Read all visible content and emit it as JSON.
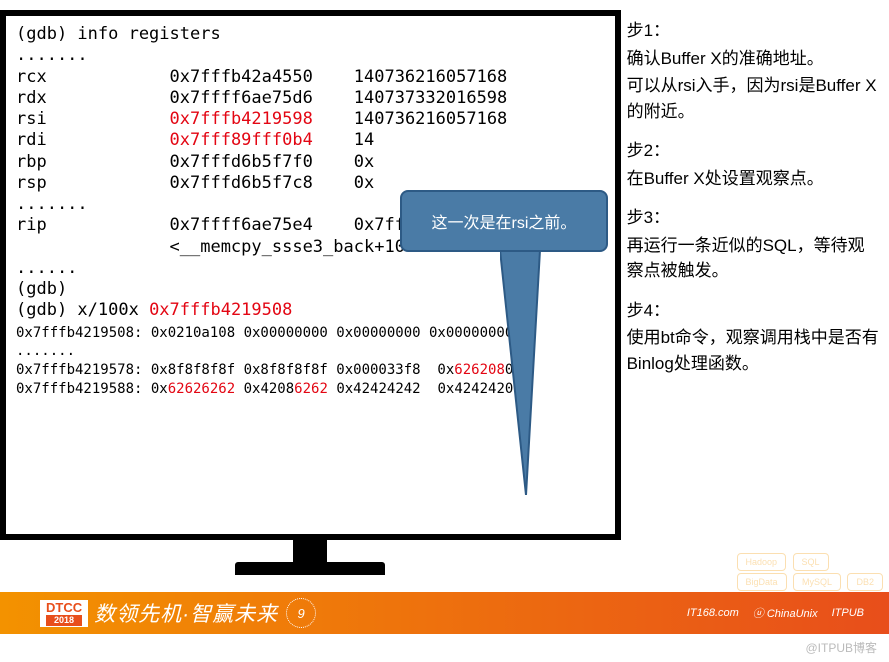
{
  "terminal": {
    "cmd1": "(gdb) info registers",
    "dots": ".......",
    "dots2": "......",
    "reg_rcx": "rcx            0x7fffb42a4550    140736216057168",
    "reg_rdx": "rdx            0x7ffff6ae75d6    140737332016598",
    "reg_rsi_name": "rsi            ",
    "reg_rsi_val": "0x7fffb4219598",
    "reg_rsi_dec": "    140736216057168",
    "reg_rdi_name": "rdi            ",
    "reg_rdi_val": "0x7fff89fff0b4",
    "reg_rdi_dec": "    14",
    "reg_rbp": "rbp            0x7fffd6b5f7f0    0x",
    "reg_rsp": "rsp            0x7fffd6b5f7c8    0x",
    "reg_rip": "rip            0x7ffff6ae75e4    0x7fff     e75e4",
    "memcpy": "               <__memcpy_ssse3_back+10    >",
    "gdb_empty": "(gdb)",
    "cmd2_pre": "(gdb) x/100x ",
    "cmd2_addr": "0x7fffb4219508",
    "mem1": "0x7fffb4219508: 0x0210a108 0x00000000 0x00000000 0x00000000",
    "mem_dots": ".......",
    "mem2_pre": "0x7fffb4219578: 0x8f8f8f8f 0x8f8f8f8f 0x000033f8  0x",
    "mem2_red": "626208",
    "mem2_post": "00",
    "mem3_pre": "0x7fffb4219588: 0x",
    "mem3_red1": "62626262",
    "mem3_mid": " 0x4208",
    "mem3_red2": "6262",
    "mem3_post": " 0x42424242  0x42424200"
  },
  "callout": "这一次是在rsi之前。",
  "steps": {
    "s1t": "步1：",
    "s1a": "确认Buffer X的准确地址。",
    "s1b": "可以从rsi入手，因为rsi是Buffer X的附近。",
    "s2t": "步2：",
    "s2a": "在Buffer X处设置观察点。",
    "s3t": "步3：",
    "s3a": "再运行一条近似的SQL，等待观察点被触发。",
    "s4t": "步4：",
    "s4a": "使用bt命令，观察调用栈中是否有Binlog处理函数。"
  },
  "footer": {
    "dtcc": "DTCC",
    "year": "2018",
    "slogan": "数领先机·智赢未来",
    "badge": "9",
    "logo1": "IT168.com",
    "logo2": "ⓤ ChinaUnix",
    "logo3": "ITPUB"
  },
  "hex_bg": {
    "h1": "Hadoop",
    "h2": "SQL",
    "h3": "BigData",
    "h4": "MySQL",
    "h5": "DB2"
  },
  "watermark": "@ITPUB博客"
}
